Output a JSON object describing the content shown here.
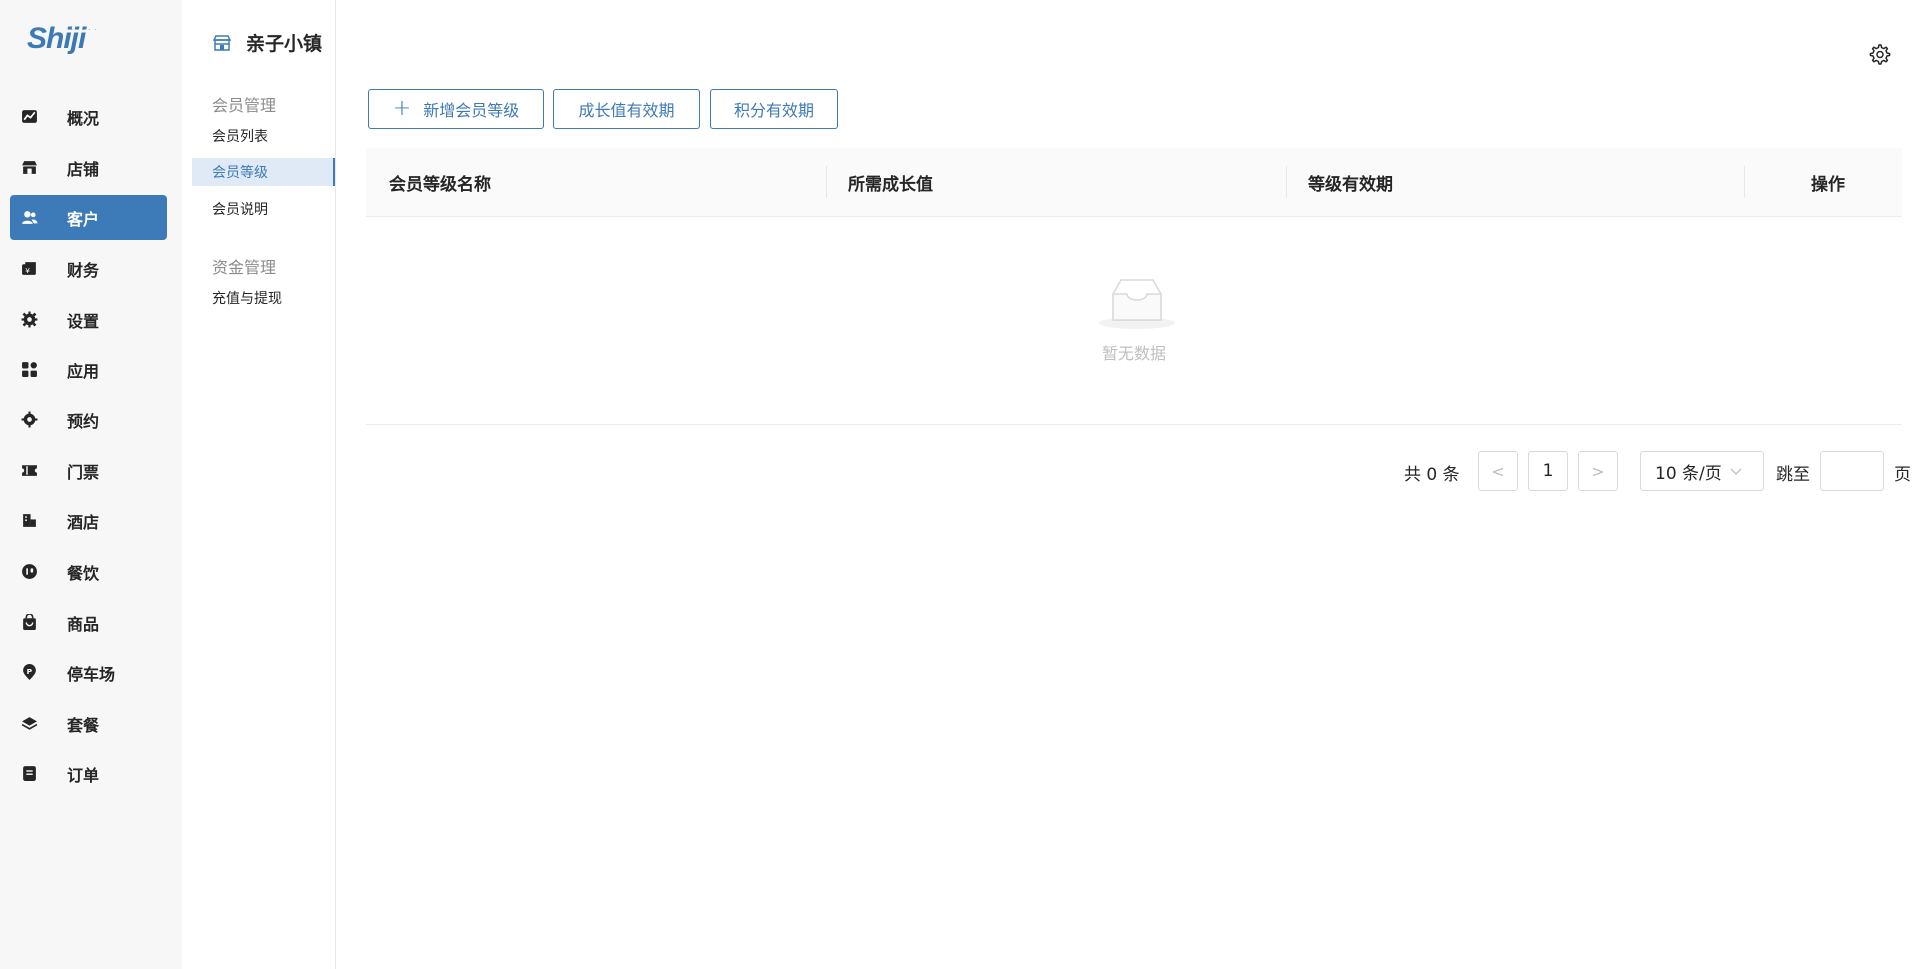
{
  "app": {
    "logo_text": "Shiji"
  },
  "sidebar": {
    "items": [
      {
        "label": "概况",
        "icon": "chart-icon"
      },
      {
        "label": "店铺",
        "icon": "store-icon"
      },
      {
        "label": "客户",
        "icon": "users-icon",
        "active": true
      },
      {
        "label": "财务",
        "icon": "wallet-icon"
      },
      {
        "label": "设置",
        "icon": "gear-icon"
      },
      {
        "label": "应用",
        "icon": "apps-icon"
      },
      {
        "label": "预约",
        "icon": "gear-icon"
      },
      {
        "label": "门票",
        "icon": "ticket-icon"
      },
      {
        "label": "酒店",
        "icon": "hotel-icon"
      },
      {
        "label": "餐饮",
        "icon": "dining-icon"
      },
      {
        "label": "商品",
        "icon": "bag-icon"
      },
      {
        "label": "停车场",
        "icon": "parking-icon"
      },
      {
        "label": "套餐",
        "icon": "layers-icon"
      },
      {
        "label": "订单",
        "icon": "order-icon"
      }
    ]
  },
  "subnav": {
    "store_name": "亲子小镇",
    "groups": [
      {
        "title": "会员管理",
        "items": [
          {
            "label": "会员列表"
          },
          {
            "label": "会员等级",
            "active": true
          },
          {
            "label": "会员说明"
          }
        ]
      },
      {
        "title": "资金管理",
        "items": [
          {
            "label": "充值与提现"
          }
        ]
      }
    ]
  },
  "toolbar": {
    "add_label": "新增会员等级",
    "growth_validity_label": "成长值有效期",
    "points_validity_label": "积分有效期"
  },
  "table": {
    "columns": [
      "会员等级名称",
      "所需成长值",
      "等级有效期",
      "操作"
    ],
    "rows": [],
    "empty_text": "暂无数据"
  },
  "pagination": {
    "total_text": "共 0 条",
    "prev": "<",
    "current_page": "1",
    "next": ">",
    "page_size": "10 条/页",
    "jump_label": "跳至",
    "jump_value": "",
    "page_suffix": "页"
  },
  "colors": {
    "accent": "#3d7ab8",
    "sidebar_bg": "#f7f7f7"
  }
}
